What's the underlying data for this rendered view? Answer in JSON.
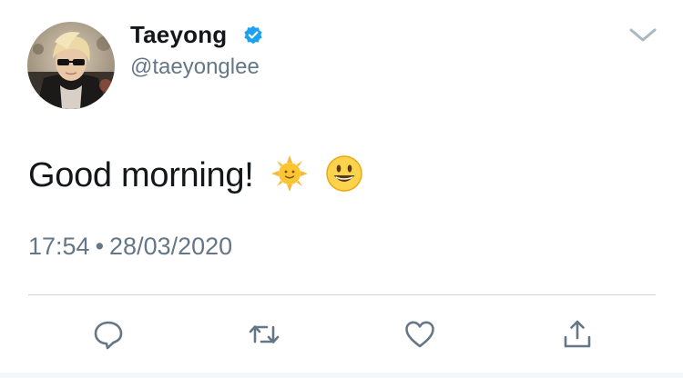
{
  "tweet": {
    "author": {
      "display_name": "Taeyong",
      "handle": "@taeyonglee",
      "verified": true
    },
    "text": "Good morning!",
    "emojis": [
      "sun-with-face-emoji",
      "grinning-face-emoji"
    ],
    "time": "17:54",
    "separator": "•",
    "date": "28/03/2020"
  },
  "actions": [
    "reply-icon",
    "retweet-icon",
    "like-icon",
    "share-icon"
  ],
  "colors": {
    "text": "#14171a",
    "secondary": "#657786",
    "accent": "#1da1f2",
    "divider": "#ccd6dd"
  }
}
